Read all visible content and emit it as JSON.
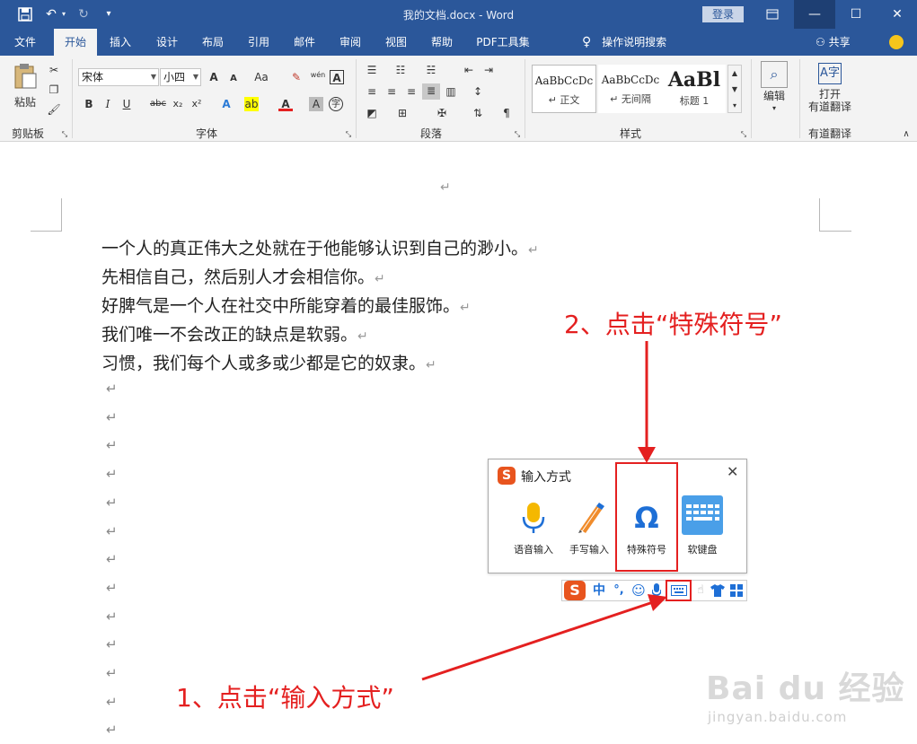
{
  "window": {
    "title": "我的文档.docx  -  Word",
    "login_label": "登录",
    "ribbon_options_icon": "ribbon-display-icon",
    "minimize_icon": "minimize-icon",
    "maximize_icon": "maximize-icon",
    "close_icon": "close-icon"
  },
  "quick_access": {
    "save_icon": "save-icon",
    "undo_icon": "undo-icon",
    "redo_icon": "redo-icon",
    "customize_icon": "customize-qat-icon"
  },
  "tabs": [
    "文件",
    "开始",
    "插入",
    "设计",
    "布局",
    "引用",
    "邮件",
    "审阅",
    "视图",
    "帮助",
    "PDF工具集"
  ],
  "active_tab": "开始",
  "tell_me": "操作说明搜索",
  "share": "共享",
  "ribbon": {
    "clipboard": {
      "paste_label": "粘贴",
      "group_label": "剪贴板"
    },
    "font": {
      "font_name": "宋体",
      "font_size": "小四",
      "group_label": "字体",
      "bold": "B",
      "italic": "I",
      "underline": "U",
      "strike": "abc",
      "subscript": "x₂",
      "superscript": "x²",
      "grow": "A",
      "shrink": "A",
      "case": "Aa",
      "phonetic": "wén",
      "border_char": "A",
      "enclose_char": "字"
    },
    "paragraph": {
      "group_label": "段落"
    },
    "styles": {
      "group_label": "样式",
      "cards": [
        {
          "preview": "AaBbCcDc",
          "name": "↵ 正文"
        },
        {
          "preview": "AaBbCcDc",
          "name": "↵ 无间隔"
        },
        {
          "preview": "AaBl",
          "name": "标题 1"
        }
      ]
    },
    "editing": {
      "label": "编辑"
    },
    "translate": {
      "label_line1": "打开",
      "label_line2": "有道翻译",
      "group_label": "有道翻译"
    }
  },
  "document": {
    "top_mark": "↵",
    "lines": [
      "一个人的真正伟大之处就在于他能够认识到自己的渺小。",
      "先相信自己，然后别人才会相信你。",
      "好脾气是一个人在社交中所能穿着的最佳服饰。",
      "我们唯一不会改正的缺点是软弱。",
      "习惯，我们每个人或多或少都是它的奴隶。"
    ],
    "paragraph_mark": "↵",
    "empty_lines": 13
  },
  "ime_popup": {
    "title": "输入方式",
    "close": "✕",
    "logo": "S",
    "options": [
      {
        "label": "语音输入",
        "icon": "microphone-icon"
      },
      {
        "label": "手写输入",
        "icon": "pencil-icon"
      },
      {
        "label": "特殊符号",
        "icon": "omega-icon"
      },
      {
        "label": "软键盘",
        "icon": "keyboard-icon"
      }
    ]
  },
  "ime_toolbar": {
    "logo": "S",
    "chinese": "中",
    "punct": "°,",
    "emoji_icon": "smiley-icon",
    "mic_icon": "microphone-icon",
    "keyboard_icon": "keyboard-icon",
    "skin_icon": "tshirt-icon",
    "grid_icon": "grid-icon"
  },
  "annotations": {
    "step1": "1、点击“输入方式”",
    "step2": "2、点击“特殊符号”"
  },
  "watermark": {
    "main": "Bai du 经验",
    "sub": "jingyan.baidu.com"
  },
  "colors": {
    "titlebar": "#2b579a",
    "annotation": "#e42020",
    "sogou": "#e8541e",
    "accent_blue": "#1e6fd6"
  }
}
